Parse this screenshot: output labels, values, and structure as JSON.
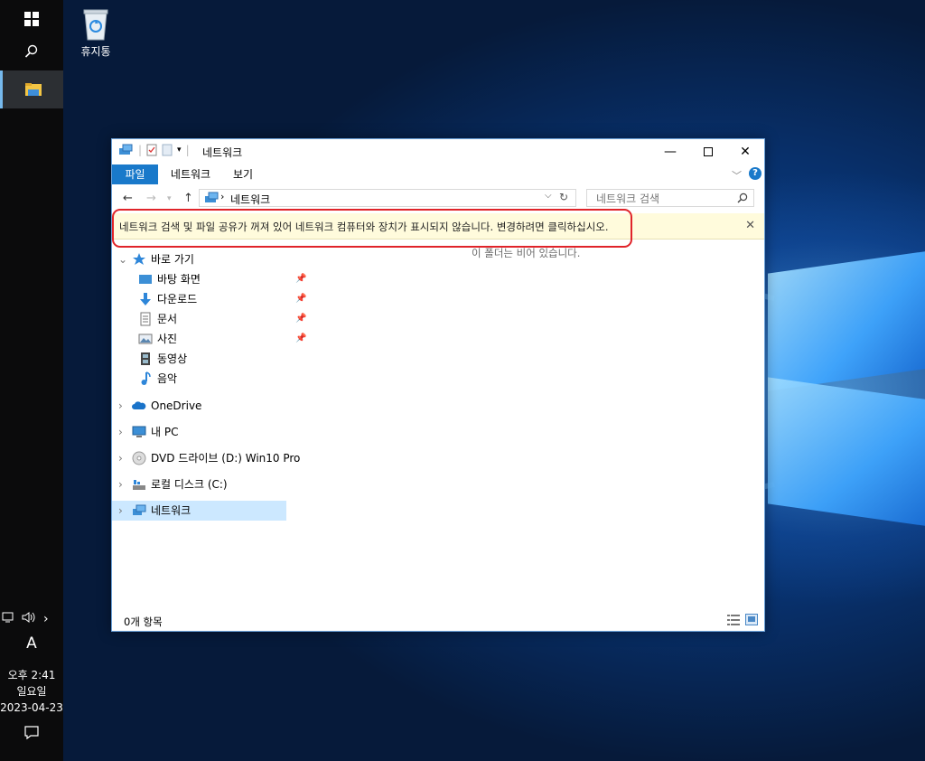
{
  "desktop": {
    "recycle_bin_label": "휴지통"
  },
  "taskbar": {
    "ime_indicator": "A",
    "clock": {
      "time": "오후 2:41",
      "weekday": "일요일",
      "date": "2023-04-23"
    }
  },
  "explorer": {
    "title": "네트워크",
    "ribbon_tabs": [
      "파일",
      "네트워크",
      "보기"
    ],
    "address_path": "네트워크",
    "search_placeholder": "네트워크 검색",
    "info_bar_message": "네트워크 검색 및 파일 공유가 꺼져 있어 네트워크 컴퓨터와 장치가 표시되지 않습니다. 변경하려면 클릭하십시오.",
    "empty_message": "이 폴더는 비어 있습니다.",
    "status_count": "0개 항목",
    "nav": {
      "quick_access": "바로 가기",
      "quick_items": [
        "바탕 화면",
        "다운로드",
        "문서",
        "사진",
        "동영상",
        "음악"
      ],
      "onedrive": "OneDrive",
      "this_pc": "내 PC",
      "dvd_drive": "DVD 드라이브 (D:) Win10 Pro",
      "local_disk": "로컬 디스크 (C:)",
      "network": "네트워크"
    }
  },
  "colors": {
    "file_tab": "#1979ca",
    "info_bar": "#fffbdc",
    "highlight_border": "#e0242a",
    "selected_nav": "#cce8ff"
  }
}
